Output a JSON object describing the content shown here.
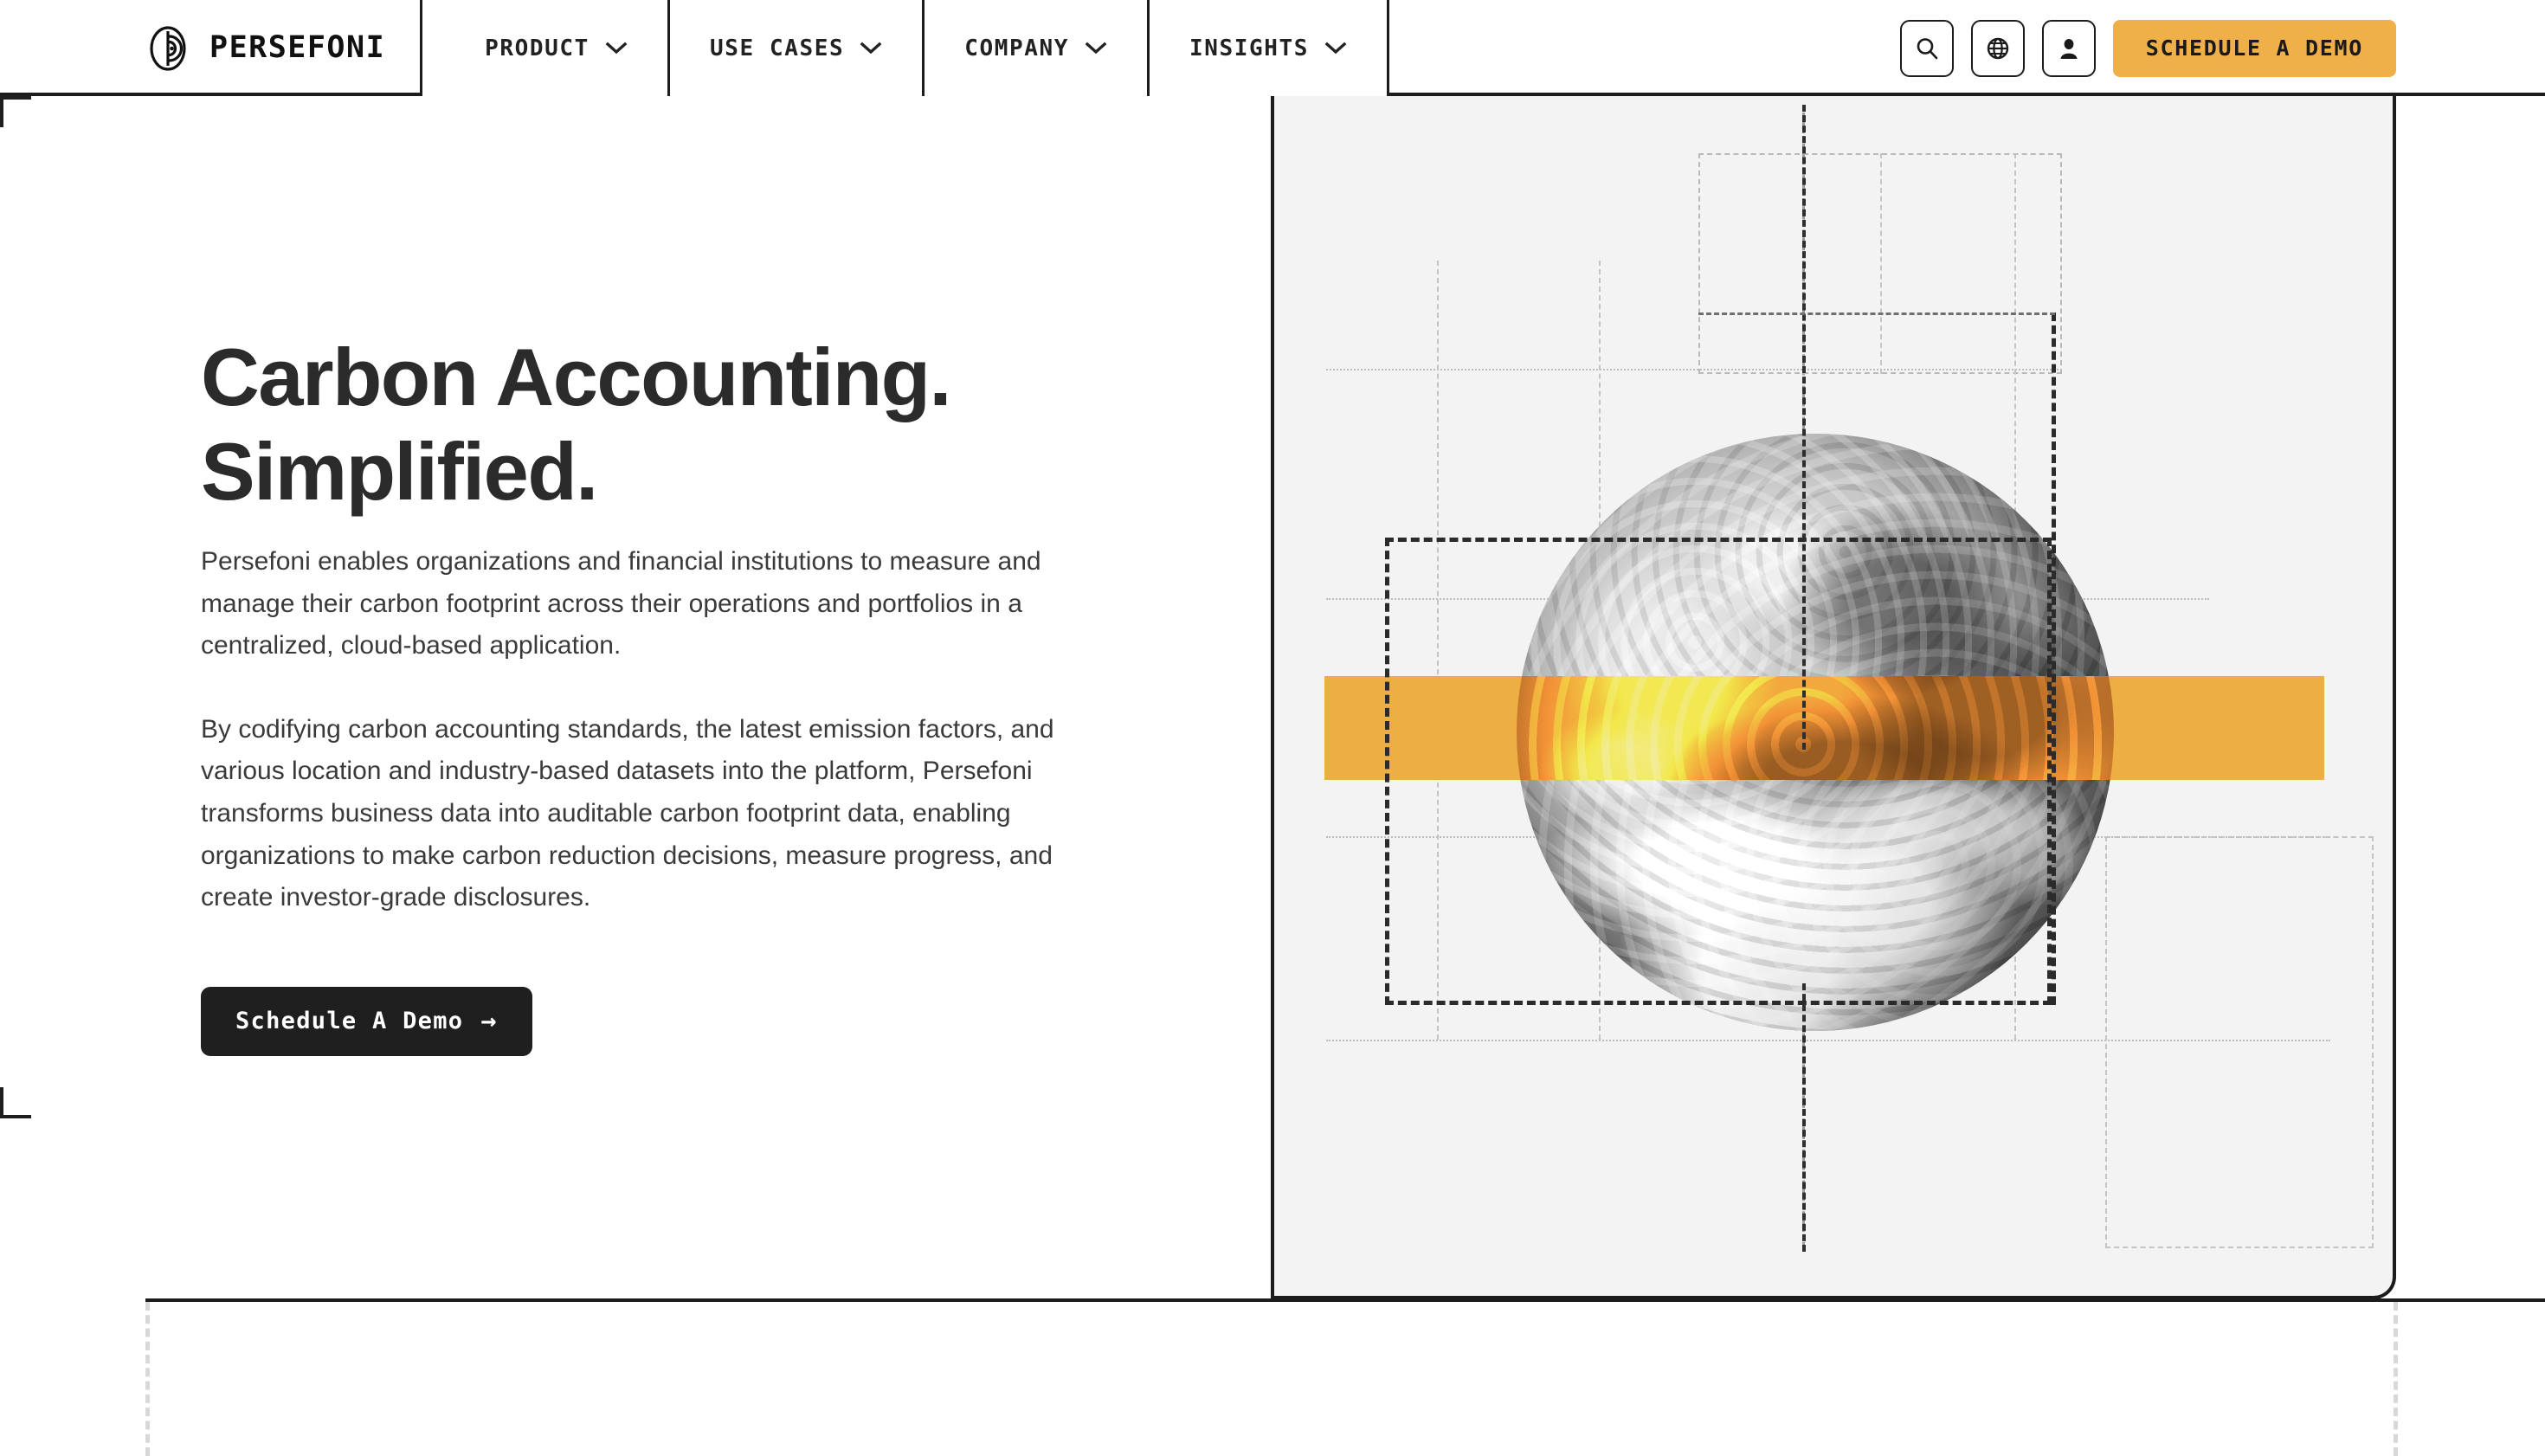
{
  "brand": {
    "name": "PERSEFONI",
    "logo_icon": "persefoni-circle-mark"
  },
  "nav": {
    "items": [
      {
        "label": "PRODUCT",
        "icon": "chevron-down-icon"
      },
      {
        "label": "USE CASES",
        "icon": "chevron-down-icon"
      },
      {
        "label": "COMPANY",
        "icon": "chevron-down-icon"
      },
      {
        "label": "INSIGHTS",
        "icon": "chevron-down-icon"
      }
    ]
  },
  "header_actions": {
    "search_icon": "search-icon",
    "language_icon": "globe-icon",
    "account_icon": "user-icon",
    "demo_button_label": "SCHEDULE A DEMO"
  },
  "hero": {
    "headline_line1": "Carbon Accounting.",
    "headline_line2": "Simplified.",
    "paragraph1": "Persefoni enables organizations and financial institutions to measure and manage their carbon footprint across their operations and portfolios in a centralized, cloud-based application.",
    "paragraph2": "By codifying carbon accounting standards, the latest emission factors, and various location and industry-based datasets into the platform, Persefoni transforms business data into auditable carbon footprint data, enabling organizations to make carbon reduction decisions, measure progress, and create investor-grade disclosures.",
    "cta_label": "Schedule A Demo",
    "cta_arrow": "→",
    "visual": {
      "globe_image": "earth-globe-grayscale",
      "accent_band": "horizontal-amber-band",
      "decorative_grid": "dashed-measurement-grid"
    }
  },
  "colors": {
    "accent_amber": "#EFB04A",
    "band_amber": "#EDAE43",
    "ink": "#1c1c1c",
    "panel_gray": "#f3f3f3",
    "body_text": "#3a3a3a",
    "headline_text": "#2b2b2b"
  }
}
